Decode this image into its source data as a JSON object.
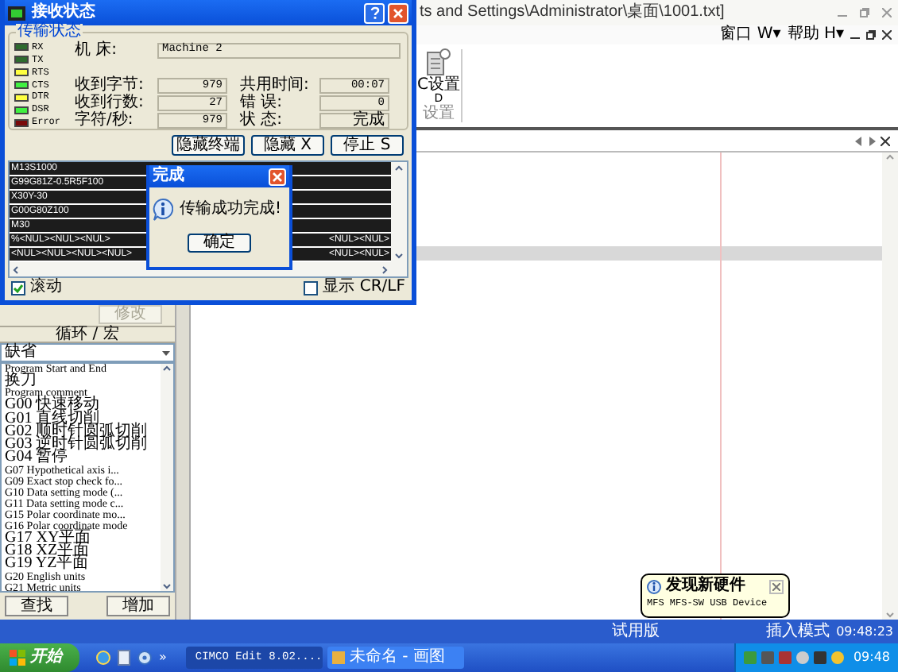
{
  "main_window": {
    "title": "ts and Settings\\Administrator\\桌面\\1001.txt]",
    "menu": [
      "窗口 W▾",
      "帮助 H▾"
    ],
    "ribbon": {
      "button_label": "C设置",
      "button_key": "D",
      "group_label": "设置"
    }
  },
  "macro_panel": {
    "modify_button": {
      "label": "修改",
      "disabled": true
    },
    "header": "循环 / 宏",
    "dropdown": {
      "value": "缺省"
    },
    "items": [
      "Program Start and End",
      "换刀",
      "Program comment",
      "G00 快速移动",
      "G01 直线切削",
      "G02 顺时针圆弧切削",
      "G03 逆时针圆弧切削",
      "G04 暂停",
      "G07 Hypothetical axis i...",
      "G09 Exact stop check fo...",
      "G10 Data setting mode (...",
      "G11 Data setting mode c...",
      "G15 Polar coordinate mo...",
      "G16 Polar coordinate mode",
      "G17 XY平面",
      "G18 XZ平面",
      "G19 YZ平面",
      "G20 English units",
      "G21 Metric units"
    ],
    "buttons": [
      "查找",
      "增加"
    ]
  },
  "status_bar": [
    "试用版",
    "插入模式",
    "09:48:23"
  ],
  "taskbar": {
    "start": "开始",
    "more": "»",
    "tasks": [
      {
        "label": "CIMCO Edit 8.02....",
        "selected": true
      },
      {
        "label": "未命名 - 画图",
        "selected": false
      }
    ],
    "clock": "09:48"
  },
  "receive_dialog": {
    "title": "接收状态",
    "group": "传输状态",
    "leds": [
      {
        "label": "RX",
        "color": "#2e6b2e"
      },
      {
        "label": "TX",
        "color": "#2e6b2e"
      },
      {
        "label": "RTS",
        "color": "#ffff40"
      },
      {
        "label": "CTS",
        "color": "#40f040"
      },
      {
        "label": "DTR",
        "color": "#ffff40"
      },
      {
        "label": "DSR",
        "color": "#40f040"
      },
      {
        "label": "Error",
        "color": "#7a0a0a"
      }
    ],
    "machine": {
      "label": "机 床:",
      "value": "Machine 2"
    },
    "stats": [
      {
        "label": "收到字节:",
        "value": "979"
      },
      {
        "label": "共用时间:",
        "value": "00:07"
      },
      {
        "label": "收到行数:",
        "value": "27"
      },
      {
        "label": "错 误:",
        "value": "0"
      },
      {
        "label": "字符/秒:",
        "value": "979"
      },
      {
        "label": "状 态:",
        "value": "完成"
      }
    ],
    "buttons": [
      "隐藏终端",
      "隐藏 X",
      "停止 S"
    ],
    "terminal": [
      {
        "left": "M13S1000"
      },
      {
        "left": "G99G81Z-0.5R5F100"
      },
      {
        "left": "X30Y-30"
      },
      {
        "left": "G00G80Z100"
      },
      {
        "left": "M30"
      },
      {
        "left": "%<NUL><NUL><NUL>",
        "right": "<NUL><NUL>"
      },
      {
        "left": "<NUL><NUL><NUL><NUL>",
        "right": "<NUL><NUL>"
      }
    ],
    "scroll": {
      "label": "滚动",
      "checked": true
    },
    "crlf": {
      "label": "显示 CR/LF",
      "checked": false
    }
  },
  "done_dialog": {
    "title": "完成",
    "message": "传输成功完成!",
    "ok": "确定"
  },
  "balloon": {
    "title": "发现新硬件",
    "message": "MFS MFS-SW USB Device"
  }
}
